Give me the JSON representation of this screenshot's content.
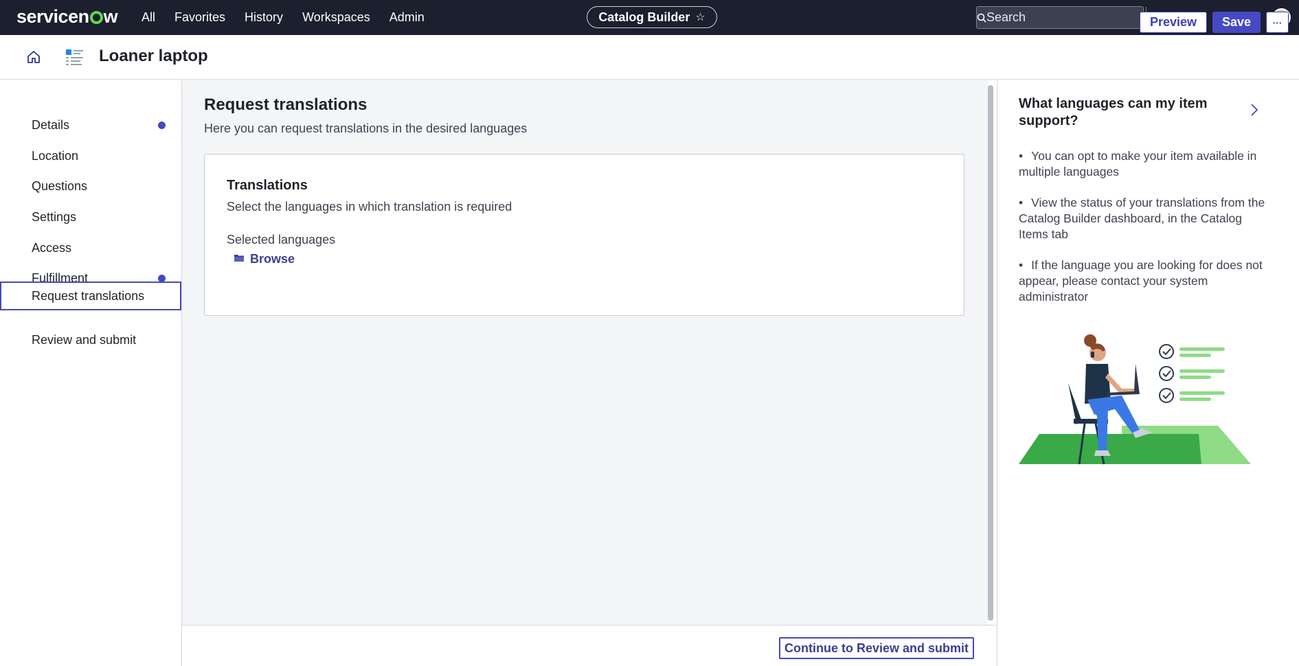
{
  "topbar": {
    "brand": "servicenow",
    "nav": [
      "All",
      "Favorites",
      "History",
      "Workspaces",
      "Admin"
    ],
    "app_pill": "Catalog Builder",
    "search_placeholder": "Search",
    "icons": [
      "globe-icon",
      "chat-icon",
      "help-icon",
      "bell-icon"
    ]
  },
  "header": {
    "title": "Loaner laptop",
    "preview_label": "Preview",
    "save_label": "Save",
    "more_label": "···"
  },
  "sidebar": {
    "items": [
      {
        "label": "Details",
        "indicator": true
      },
      {
        "label": "Location",
        "indicator": false
      },
      {
        "label": "Questions",
        "indicator": false
      },
      {
        "label": "Settings",
        "indicator": false
      },
      {
        "label": "Access",
        "indicator": false
      },
      {
        "label": "Fulfillment",
        "indicator": true
      },
      {
        "label": "Request translations",
        "indicator": false,
        "active": true
      },
      {
        "label": "Review and submit",
        "indicator": false
      }
    ]
  },
  "main": {
    "title": "Request translations",
    "subtitle": "Here you can request translations in the desired languages",
    "card": {
      "title": "Translations",
      "subtitle": "Select the languages in which translation is required",
      "field_label": "Selected languages",
      "browse_label": "Browse"
    }
  },
  "footer": {
    "continue_label": "Continue to Review and submit"
  },
  "help": {
    "title": "What languages can my item support?",
    "bullets": [
      "You can opt to make your item available in multiple languages",
      "View the status of your translations from the Catalog Builder dashboard, in the Catalog Items tab",
      "If the language you are looking for does not appear, please contact your system administrator"
    ]
  },
  "colors": {
    "topbar_bg": "#1c1f2e",
    "accent": "#4549c4",
    "brand_green": "#62d84e",
    "content_bg": "#f4f5f7"
  }
}
